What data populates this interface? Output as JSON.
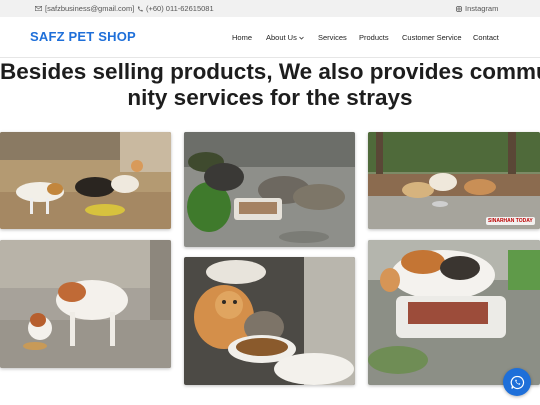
{
  "topbar": {
    "email": "[safzbusiness@gmail.com]",
    "phone": "(+60) 011-62615081",
    "instagram": "Instagram"
  },
  "brand": {
    "name": "SAFZ PET SHOP",
    "color": "#1e6fd9"
  },
  "nav": {
    "home": "Home",
    "about": "About Us",
    "services": "Services",
    "products": "Products",
    "customer_service": "Customer Service",
    "contact": "Contact"
  },
  "hero": {
    "line1": "Besides selling products, We also provides commu",
    "line2": "nity services for the strays"
  },
  "gallery": {
    "watermark": "SINARHAN TODAY"
  },
  "icons": {
    "email": "envelope-icon",
    "phone": "phone-icon",
    "instagram": "instagram-icon",
    "about_dropdown": "chevron-down-icon",
    "whatsapp": "whatsapp-icon"
  }
}
